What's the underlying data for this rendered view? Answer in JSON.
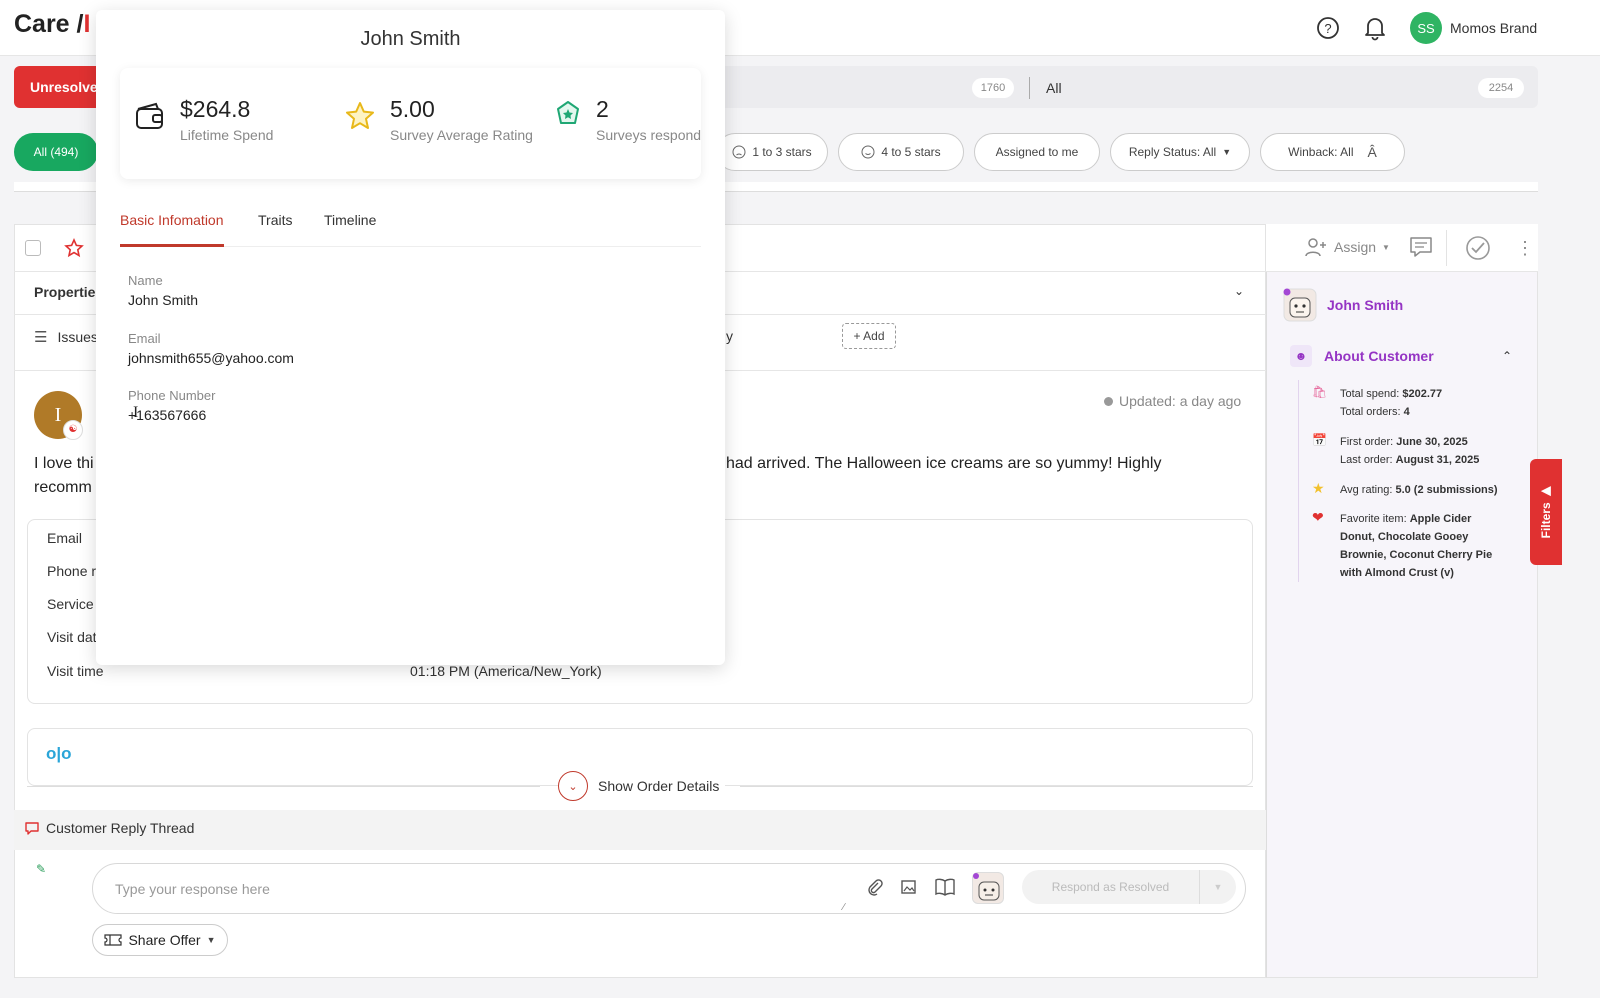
{
  "header": {
    "brand_prefix": "Care /",
    "brand_suffix": "I",
    "help_icon": "question-circle-icon",
    "bell_icon": "bell-icon",
    "avatar_initials": "SS",
    "account_name": "Momos Brand"
  },
  "status_tabs": {
    "unresolved_label": "Unresolve",
    "count_a": "1760",
    "all_label": "All",
    "count_all": "2254"
  },
  "filters": {
    "all_chip": "All (494)",
    "chips": [
      "1 to 3 stars",
      "4 to 5 stars",
      "Assigned to me",
      "Reply Status: All",
      "Winback: All"
    ]
  },
  "toolbar": {
    "assign_label": "Assign",
    "properties_label": "Propertie",
    "issues_label": "Issues",
    "y_fragment": "y",
    "add_label": "+ Add"
  },
  "review": {
    "avatar_letter": "I",
    "updated_text": "Updated: a day ago",
    "body_line1_left": "I love thi",
    "body_line1_right": "had arrived. The Halloween ice creams are so yummy! Highly",
    "body_line2": "recomm"
  },
  "details": {
    "rows": [
      {
        "label": "Email"
      },
      {
        "label": "Phone r"
      },
      {
        "label": "Service"
      },
      {
        "label": "Visit dat"
      },
      {
        "label": "Visit time",
        "value": "01:18 PM (America/New_York)"
      }
    ],
    "order_logo": "o|o",
    "show_order_details": "Show Order Details"
  },
  "thread": {
    "title": "Customer Reply Thread",
    "placeholder": "Type your response here",
    "respond_button": "Respond as Resolved",
    "share_offer": "Share Offer"
  },
  "right_panel": {
    "customer_name": "John Smith",
    "about_title": "About Customer",
    "items": [
      {
        "icon": "shopping-bag-icon",
        "lines": [
          [
            "Total spend: ",
            "$202.77"
          ],
          [
            "Total orders: ",
            "4"
          ]
        ]
      },
      {
        "icon": "calendar-icon",
        "lines": [
          [
            "First order: ",
            "June 30, 2025"
          ],
          [
            "Last order: ",
            "August 31, 2025"
          ]
        ]
      },
      {
        "icon": "star-icon",
        "lines": [
          [
            "Avg rating: ",
            "5.0 (2 submissions)"
          ]
        ]
      },
      {
        "icon": "heart-icon",
        "lines": [
          [
            "Favorite item: ",
            "Apple Cider"
          ],
          [
            "",
            "Donut, Chocolate Gooey"
          ],
          [
            "",
            "Brownie, Coconut Cherry Pie"
          ],
          [
            "",
            "with Almond Crust (v)"
          ]
        ]
      }
    ],
    "filters_tab": "Filters"
  },
  "popup": {
    "title": "John Smith",
    "stats": [
      {
        "value": "$264.8",
        "label": "Lifetime Spend",
        "icon": "wallet-icon"
      },
      {
        "value": "5.00",
        "label": "Survey Average Rating",
        "icon": "star-outline-icon"
      },
      {
        "value": "2",
        "label": "Surveys respond",
        "icon": "star-badge-icon"
      }
    ],
    "tabs": [
      "Basic Infomation",
      "Traits",
      "Timeline"
    ],
    "active_tab": 0,
    "fields": [
      {
        "label": "Name",
        "value": "John Smith"
      },
      {
        "label": "Email",
        "value": "johnsmith655@yahoo.com"
      },
      {
        "label": "Phone Number",
        "value": "+163567666"
      }
    ]
  }
}
